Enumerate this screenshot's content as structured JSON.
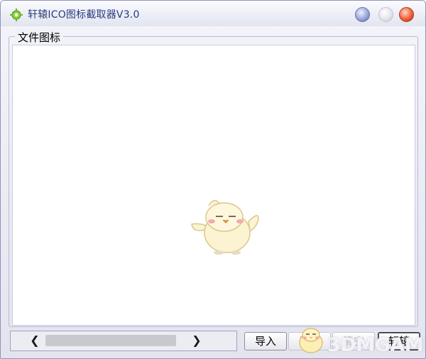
{
  "window": {
    "title": "轩辕ICO图标截取器V3.0"
  },
  "group": {
    "title": "文件图标"
  },
  "scrollbar": {
    "left_arrow": "❮",
    "right_arrow": "❯"
  },
  "buttons": {
    "import": "导入",
    "export": "导出",
    "clear": "清空",
    "xuanyuan": "轩辕"
  },
  "watermark": {
    "text": "3DMGAME"
  },
  "colors": {
    "title_text": "#2a3a7a",
    "close_button": "#f0603a",
    "minimize_button": "#9aa6d8"
  }
}
